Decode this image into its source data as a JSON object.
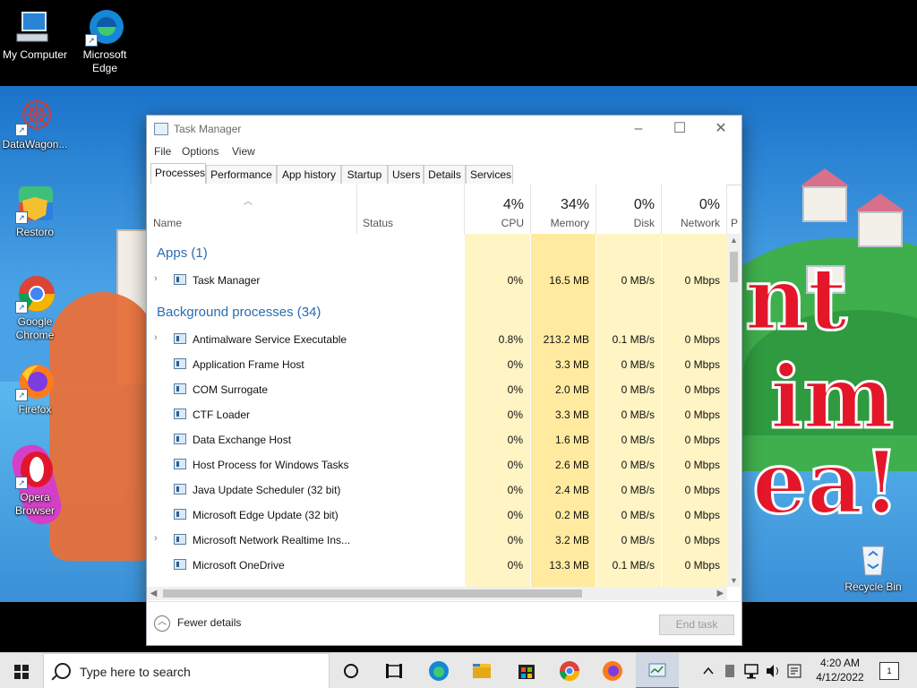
{
  "desktop": {
    "icons": [
      {
        "label": "My Computer",
        "icon": "monitor-icon"
      },
      {
        "label": "Microsoft Edge",
        "icon": "edge-icon"
      },
      {
        "label": "DataWagon...",
        "icon": "datawagon-icon"
      },
      {
        "label": "Restoro",
        "icon": "restoro-icon"
      },
      {
        "label": "Google Chrome",
        "icon": "chrome-icon"
      },
      {
        "label": "Firefox",
        "icon": "firefox-icon"
      },
      {
        "label": "Opera Browser",
        "icon": "opera-icon"
      },
      {
        "label": "Recycle Bin",
        "icon": "recycle-bin-icon"
      }
    ],
    "wallpaper_text": "nt im ea!"
  },
  "window": {
    "title": "Task Manager",
    "controls": {
      "minimize": "–",
      "maximize": "☐",
      "close": "✕"
    },
    "menu": [
      "File",
      "Options",
      "View"
    ],
    "tabs": [
      "Processes",
      "Performance",
      "App history",
      "Startup",
      "Users",
      "Details",
      "Services"
    ],
    "active_tab": "Processes"
  },
  "columns": {
    "name": "Name",
    "status": "Status",
    "cpu": {
      "pct": "4%",
      "label": "CPU"
    },
    "memory": {
      "pct": "34%",
      "label": "Memory"
    },
    "disk": {
      "pct": "0%",
      "label": "Disk"
    },
    "network": {
      "pct": "0%",
      "label": "Network"
    },
    "power": "P"
  },
  "groups": {
    "apps": "Apps (1)",
    "background": "Background processes (34)"
  },
  "apps": [
    {
      "name": "Task Manager",
      "cpu": "0%",
      "memory": "16.5 MB",
      "disk": "0 MB/s",
      "network": "0 Mbps",
      "expandable": true
    }
  ],
  "processes": [
    {
      "name": "Antimalware Service Executable",
      "cpu": "0.8%",
      "memory": "213.2 MB",
      "disk": "0.1 MB/s",
      "network": "0 Mbps",
      "expandable": true
    },
    {
      "name": "Application Frame Host",
      "cpu": "0%",
      "memory": "3.3 MB",
      "disk": "0 MB/s",
      "network": "0 Mbps",
      "expandable": false
    },
    {
      "name": "COM Surrogate",
      "cpu": "0%",
      "memory": "2.0 MB",
      "disk": "0 MB/s",
      "network": "0 Mbps",
      "expandable": false
    },
    {
      "name": "CTF Loader",
      "cpu": "0%",
      "memory": "3.3 MB",
      "disk": "0 MB/s",
      "network": "0 Mbps",
      "expandable": false
    },
    {
      "name": "Data Exchange Host",
      "cpu": "0%",
      "memory": "1.6 MB",
      "disk": "0 MB/s",
      "network": "0 Mbps",
      "expandable": false
    },
    {
      "name": "Host Process for Windows Tasks",
      "cpu": "0%",
      "memory": "2.6 MB",
      "disk": "0 MB/s",
      "network": "0 Mbps",
      "expandable": false
    },
    {
      "name": "Java Update Scheduler (32 bit)",
      "cpu": "0%",
      "memory": "2.4 MB",
      "disk": "0 MB/s",
      "network": "0 Mbps",
      "expandable": false
    },
    {
      "name": "Microsoft Edge Update (32 bit)",
      "cpu": "0%",
      "memory": "0.2 MB",
      "disk": "0 MB/s",
      "network": "0 Mbps",
      "expandable": false
    },
    {
      "name": "Microsoft Network Realtime Ins...",
      "cpu": "0%",
      "memory": "3.2 MB",
      "disk": "0 MB/s",
      "network": "0 Mbps",
      "expandable": true
    },
    {
      "name": "Microsoft OneDrive",
      "cpu": "0%",
      "memory": "13.3 MB",
      "disk": "0.1 MB/s",
      "network": "0 Mbps",
      "expandable": false
    }
  ],
  "footer": {
    "fewer_details": "Fewer details",
    "end_task": "End task"
  },
  "taskbar": {
    "search_placeholder": "Type here to search",
    "time": "4:20 AM",
    "date": "4/12/2022",
    "notification_count": "1"
  },
  "colors": {
    "heat_light": "#fff4c4",
    "heat_medium": "#ffeaa0",
    "group_text": "#2b6cb0"
  }
}
